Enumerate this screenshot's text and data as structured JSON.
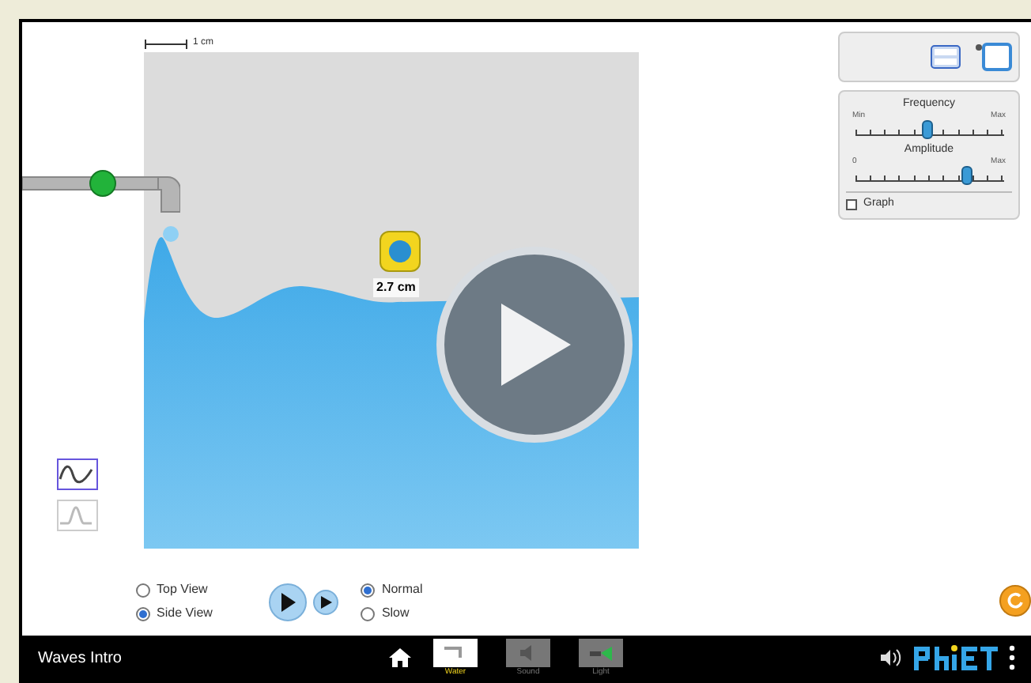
{
  "sim": {
    "scale_label": "1 cm",
    "tape_reading": "2.7 cm"
  },
  "controls": {
    "sliders": [
      {
        "label": "Frequency",
        "min_label": "Min",
        "max_label": "Max",
        "level": 0.48
      },
      {
        "label": "Amplitude",
        "min_label": "0",
        "max_label": "Max",
        "level": 0.75
      }
    ],
    "graph": {
      "label": "Graph",
      "checked": false
    }
  },
  "wave_modes": [
    {
      "kind": "continuous",
      "selected": true
    },
    {
      "kind": "pulse",
      "selected": false
    }
  ],
  "view_options": [
    {
      "label": "Top View",
      "selected": false
    },
    {
      "label": "Side View",
      "selected": true
    }
  ],
  "speed_options": [
    {
      "label": "Normal",
      "selected": true
    },
    {
      "label": "Slow",
      "selected": false
    }
  ],
  "nav": {
    "title": "Waves Intro",
    "screens": [
      {
        "label": "Water",
        "kind": "water",
        "selected": true
      },
      {
        "label": "Sound",
        "kind": "sound",
        "selected": false
      },
      {
        "label": "Light",
        "kind": "light",
        "selected": false
      }
    ]
  }
}
